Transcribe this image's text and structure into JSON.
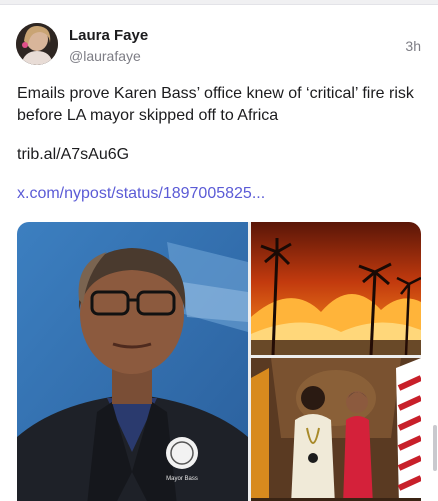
{
  "post": {
    "display_name": "Laura Faye",
    "handle": "@laurafaye",
    "timestamp": "3h",
    "text": "Emails prove Karen Bass’ office knew of ‘critical’ fire risk before LA mayor skipped off to Africa",
    "short_link": "trib.al/A7sAu6G",
    "status_link": "x.com/nypost/status/1897005825..."
  },
  "media": {
    "badge_text": "Mayor Bass"
  },
  "colors": {
    "link": "#5b5bd6",
    "secondary_text": "#7d7d85"
  }
}
